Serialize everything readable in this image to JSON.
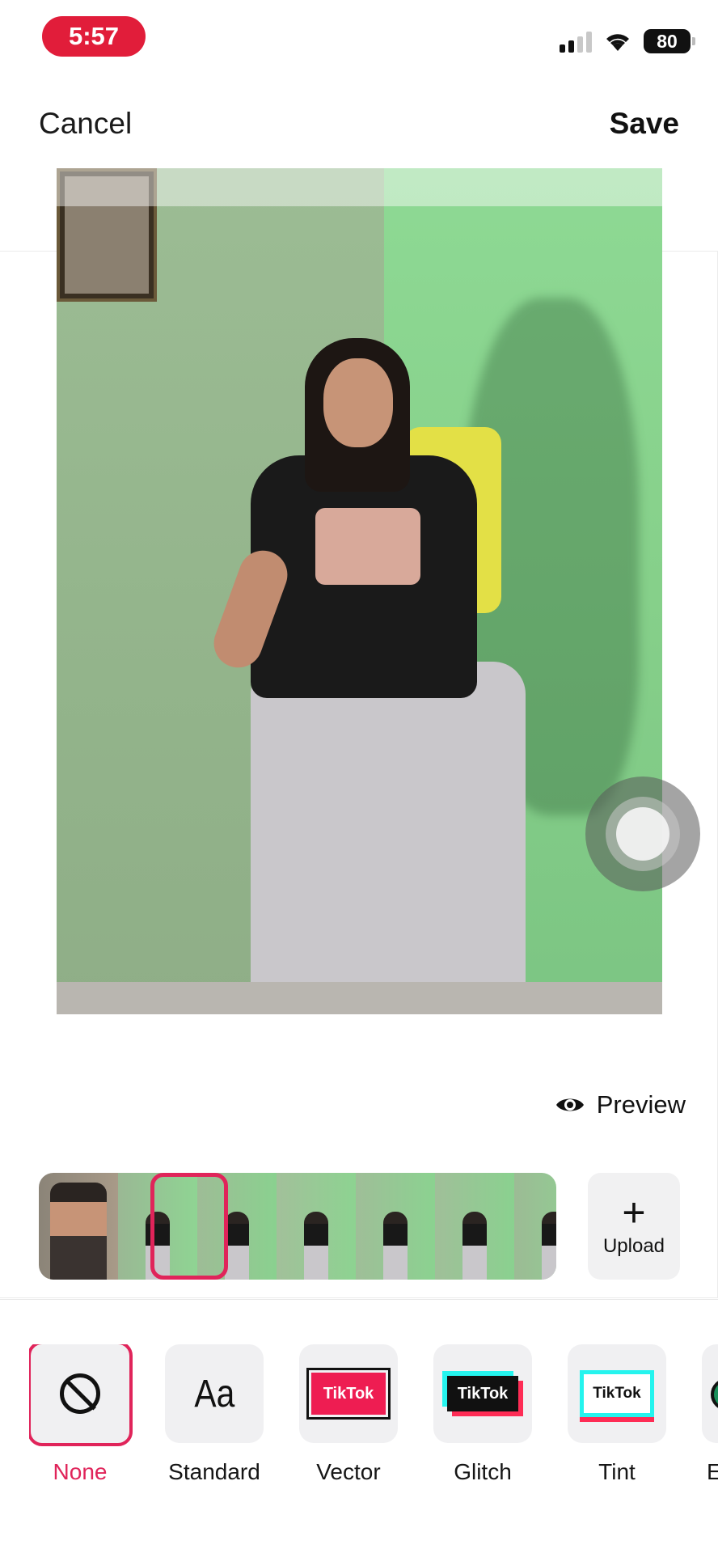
{
  "status_bar": {
    "time": "5:57",
    "battery": "80"
  },
  "header": {
    "cancel_label": "Cancel",
    "save_label": "Save"
  },
  "preview": {
    "label": "Preview"
  },
  "upload": {
    "plus": "+",
    "label": "Upload"
  },
  "thumbnails": {
    "count": 7,
    "selected_index": 1
  },
  "templates": [
    {
      "label": "None",
      "icon": "none-icon",
      "selected": true
    },
    {
      "label": "Standard",
      "icon_text": "Aa"
    },
    {
      "label": "Vector",
      "icon_text": "TikTok"
    },
    {
      "label": "Glitch",
      "icon_text": "TikTok"
    },
    {
      "label": "Tint",
      "icon_text": "TikTok"
    },
    {
      "label": "E"
    }
  ],
  "colors": {
    "accent": "#e0245a",
    "time_pill": "#e11d3a"
  }
}
